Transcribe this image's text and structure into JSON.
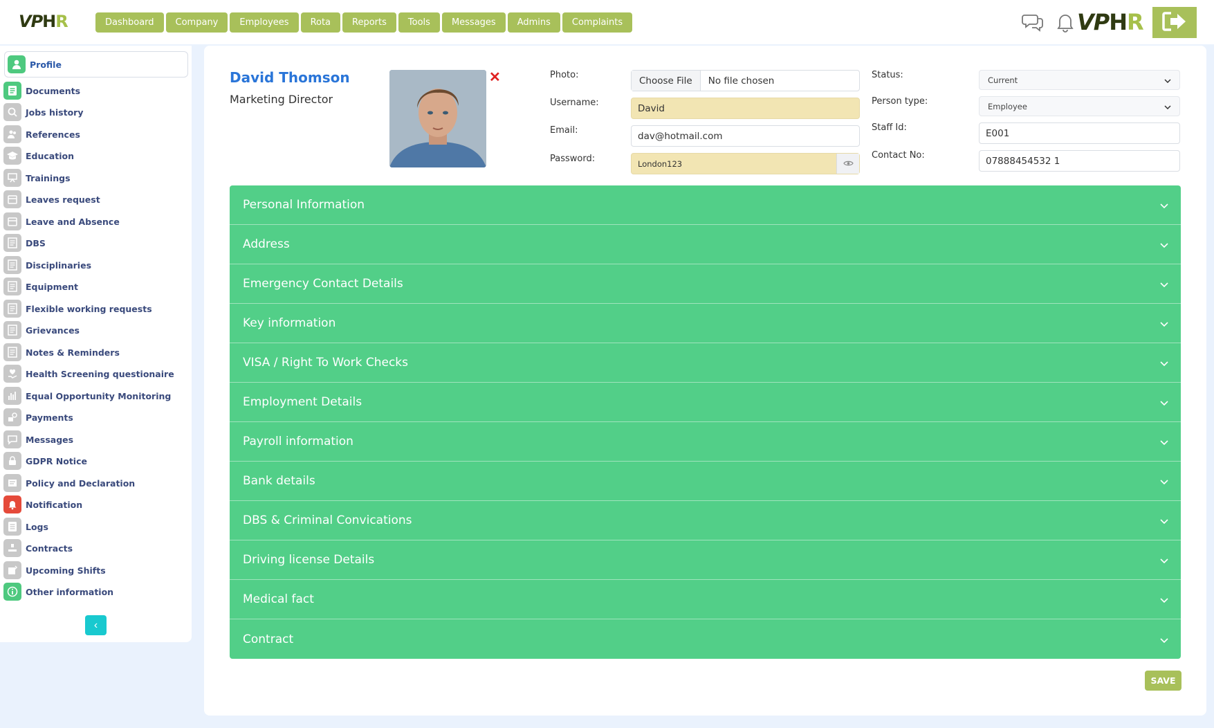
{
  "header": {
    "logo_left": {
      "vp": "VP",
      "h": "H",
      "r": "R"
    },
    "logo_right": {
      "vp": "VP",
      "h": "H",
      "r": "R"
    },
    "nav": [
      "Dashboard",
      "Company",
      "Employees",
      "Rota",
      "Reports",
      "Tools",
      "Messages",
      "Admins",
      "Complaints"
    ],
    "icons": [
      "chat-icon",
      "bell-icon",
      "logout-icon"
    ]
  },
  "sidebar": {
    "items": [
      {
        "label": "Profile",
        "icon": "user-icon"
      },
      {
        "label": "Documents",
        "icon": "document-icon"
      },
      {
        "label": "Jobs history",
        "icon": "search-icon"
      },
      {
        "label": "References",
        "icon": "people-icon"
      },
      {
        "label": "Education",
        "icon": "graduation-icon"
      },
      {
        "label": "Trainings",
        "icon": "training-icon"
      },
      {
        "label": "Leaves request",
        "icon": "calendar-icon"
      },
      {
        "label": "Leave and Absence",
        "icon": "calendar-icon"
      },
      {
        "label": "DBS",
        "icon": "doc-icon"
      },
      {
        "label": "Disciplinaries",
        "icon": "doc-icon"
      },
      {
        "label": "Equipment",
        "icon": "doc-icon"
      },
      {
        "label": "Flexible working requests",
        "icon": "doc-icon"
      },
      {
        "label": "Grievances",
        "icon": "doc-icon"
      },
      {
        "label": "Notes & Reminders",
        "icon": "doc-icon"
      },
      {
        "label": "Health Screening questionaire",
        "icon": "heart-hand-icon"
      },
      {
        "label": "Equal Opportunity Monitoring",
        "icon": "chart-icon"
      },
      {
        "label": "Payments",
        "icon": "payment-icon"
      },
      {
        "label": "Messages",
        "icon": "message-icon"
      },
      {
        "label": "GDPR Notice",
        "icon": "lock-icon"
      },
      {
        "label": "Policy and Declaration",
        "icon": "policy-icon"
      },
      {
        "label": "Notification",
        "icon": "notification-icon"
      },
      {
        "label": "Logs",
        "icon": "log-icon"
      },
      {
        "label": "Contracts",
        "icon": "contract-icon"
      },
      {
        "label": "Upcoming Shifts",
        "icon": "shift-icon"
      },
      {
        "label": "Other information",
        "icon": "info-icon"
      }
    ],
    "collapse_label": "‹"
  },
  "profile": {
    "name": "David Thomson",
    "role": "Marketing Director",
    "remove_photo": "✕"
  },
  "form": {
    "photo_label": "Photo:",
    "choose_file": "Choose File",
    "no_file": "No file chosen",
    "username_label": "Username:",
    "username": "David",
    "email_label": "Email:",
    "email": "dav@hotmail.com",
    "password_label": "Password:",
    "password": "London123",
    "status_label": "Status:",
    "status": "Current",
    "person_type_label": "Person type:",
    "person_type": "Employee",
    "staff_id_label": "Staff Id:",
    "staff_id": "E001",
    "contact_label": "Contact No:",
    "contact": "07888454532 1"
  },
  "accordion": [
    "Personal Information",
    "Address",
    "Emergency Contact Details",
    "Key information",
    "VISA / Right To Work Checks",
    "Employment Details",
    "Payroll information",
    "Bank details",
    "DBS & Criminal Convications",
    "Driving license Details",
    "Medical fact",
    "Contract"
  ],
  "save_label": "SAVE",
  "colors": {
    "accent": "#a8c05a",
    "section": "#52cf88",
    "name": "#2a75d8",
    "collapse": "#19c9cf"
  }
}
